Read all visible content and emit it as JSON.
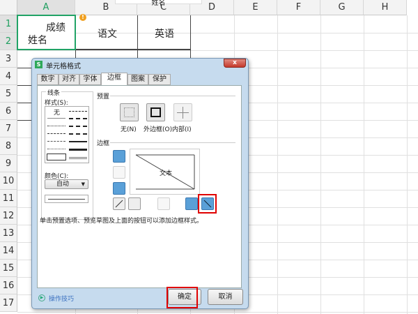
{
  "sheet": {
    "columns": [
      "A",
      "B",
      "C",
      "D",
      "E",
      "F",
      "G",
      "H"
    ],
    "rows": [
      "1",
      "2",
      "3",
      "4",
      "5",
      "6",
      "7",
      "8",
      "9",
      "10",
      "11",
      "12",
      "13",
      "14",
      "15",
      "16",
      "17"
    ],
    "cell_a1_top": "成绩",
    "cell_a1_bottom": "姓名",
    "b1": "语文",
    "c1": "英语",
    "floating_text": "姓名"
  },
  "dialog": {
    "title": "单元格格式",
    "close": "x",
    "tabs": [
      "数字",
      "对齐",
      "字体",
      "边框",
      "图案",
      "保护"
    ],
    "active_tab": "边框",
    "line_group": "线条",
    "style_label": "样式(S):",
    "style_none": "无",
    "color_label": "颜色(C):",
    "color_value": "自动",
    "preset_group": "预置",
    "presets": [
      "无(N)",
      "外边框(O)",
      "内部(I)"
    ],
    "border_group": "边框",
    "preview_text": "文本",
    "hint": "单击预置选项、预览草图及上面的按钮可以添加边框样式。",
    "tips": "操作技巧",
    "ok": "确定",
    "cancel": "取消"
  }
}
